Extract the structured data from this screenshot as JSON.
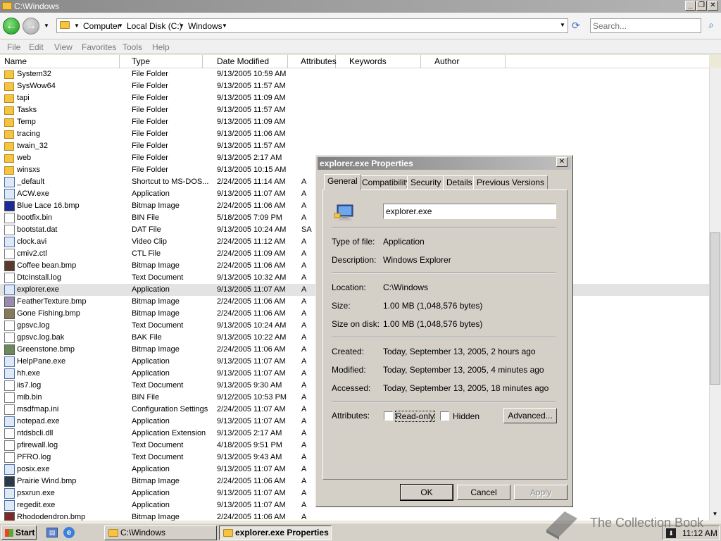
{
  "window": {
    "title": "C:\\Windows"
  },
  "nav": {
    "back_glyph": "←",
    "forward_glyph": "→",
    "breadcrumbs": [
      "Computer",
      "Local Disk (C:)",
      "Windows"
    ],
    "search_placeholder": "Search..."
  },
  "menu": [
    "File",
    "Edit",
    "View",
    "Favorites",
    "Tools",
    "Help"
  ],
  "columns": [
    "Name",
    "Type",
    "Date Modified",
    "Attributes",
    "Keywords",
    "Author"
  ],
  "files": [
    {
      "name": "System32",
      "type": "File Folder",
      "date": "9/13/2005 10:59 AM",
      "attr": "",
      "icon": "folder"
    },
    {
      "name": "SysWow64",
      "type": "File Folder",
      "date": "9/13/2005 11:57 AM",
      "attr": "",
      "icon": "folder"
    },
    {
      "name": "tapi",
      "type": "File Folder",
      "date": "9/13/2005 11:09 AM",
      "attr": "",
      "icon": "folder"
    },
    {
      "name": "Tasks",
      "type": "File Folder",
      "date": "9/13/2005 11:57 AM",
      "attr": "",
      "icon": "folder"
    },
    {
      "name": "Temp",
      "type": "File Folder",
      "date": "9/13/2005 11:09 AM",
      "attr": "",
      "icon": "folder"
    },
    {
      "name": "tracing",
      "type": "File Folder",
      "date": "9/13/2005 11:06 AM",
      "attr": "",
      "icon": "folder"
    },
    {
      "name": "twain_32",
      "type": "File Folder",
      "date": "9/13/2005 11:57 AM",
      "attr": "",
      "icon": "folder"
    },
    {
      "name": "web",
      "type": "File Folder",
      "date": "9/13/2005 2:17 AM",
      "attr": "",
      "icon": "folder"
    },
    {
      "name": "winsxs",
      "type": "File Folder",
      "date": "9/13/2005 10:15 AM",
      "attr": "",
      "icon": "folder"
    },
    {
      "name": "_default",
      "type": "Shortcut to MS-DOS...",
      "date": "2/24/2005 11:14 AM",
      "attr": "A",
      "icon": "app"
    },
    {
      "name": "ACW.exe",
      "type": "Application",
      "date": "9/13/2005 11:07 AM",
      "attr": "A",
      "icon": "app"
    },
    {
      "name": "Blue Lace 16.bmp",
      "type": "Bitmap Image",
      "date": "2/24/2005 11:06 AM",
      "attr": "A",
      "icon": "img",
      "color": "#1a2a9a"
    },
    {
      "name": "bootfix.bin",
      "type": "BIN File",
      "date": "5/18/2005 7:09 PM",
      "attr": "A",
      "icon": "doc"
    },
    {
      "name": "bootstat.dat",
      "type": "DAT File",
      "date": "9/13/2005 10:24 AM",
      "attr": "SA",
      "icon": "doc"
    },
    {
      "name": "clock.avi",
      "type": "Video Clip",
      "date": "2/24/2005 11:12 AM",
      "attr": "A",
      "icon": "app"
    },
    {
      "name": "cmiv2.ctl",
      "type": "CTL File",
      "date": "2/24/2005 11:09 AM",
      "attr": "A",
      "icon": "doc"
    },
    {
      "name": "Coffee bean.bmp",
      "type": "Bitmap Image",
      "date": "2/24/2005 11:06 AM",
      "attr": "A",
      "icon": "img",
      "color": "#5a3a2a"
    },
    {
      "name": "DtcInstall.log",
      "type": "Text Document",
      "date": "9/13/2005 10:32 AM",
      "attr": "A",
      "icon": "doc"
    },
    {
      "name": "explorer.exe",
      "type": "Application",
      "date": "9/13/2005 11:07 AM",
      "attr": "A",
      "icon": "app",
      "selected": true
    },
    {
      "name": "FeatherTexture.bmp",
      "type": "Bitmap Image",
      "date": "2/24/2005 11:06 AM",
      "attr": "A",
      "icon": "img",
      "color": "#9a8ab0"
    },
    {
      "name": "Gone Fishing.bmp",
      "type": "Bitmap Image",
      "date": "2/24/2005 11:06 AM",
      "attr": "A",
      "icon": "img",
      "color": "#8a7a5a"
    },
    {
      "name": "gpsvc.log",
      "type": "Text Document",
      "date": "9/13/2005 10:24 AM",
      "attr": "A",
      "icon": "doc"
    },
    {
      "name": "gpsvc.log.bak",
      "type": "BAK File",
      "date": "9/13/2005 10:22 AM",
      "attr": "A",
      "icon": "doc"
    },
    {
      "name": "Greenstone.bmp",
      "type": "Bitmap Image",
      "date": "2/24/2005 11:06 AM",
      "attr": "A",
      "icon": "img",
      "color": "#6a8a5a"
    },
    {
      "name": "HelpPane.exe",
      "type": "Application",
      "date": "9/13/2005 11:07 AM",
      "attr": "A",
      "icon": "app"
    },
    {
      "name": "hh.exe",
      "type": "Application",
      "date": "9/13/2005 11:07 AM",
      "attr": "A",
      "icon": "app"
    },
    {
      "name": "iis7.log",
      "type": "Text Document",
      "date": "9/13/2005 9:30 AM",
      "attr": "A",
      "icon": "doc"
    },
    {
      "name": "mib.bin",
      "type": "BIN File",
      "date": "9/12/2005 10:53 PM",
      "attr": "A",
      "icon": "doc"
    },
    {
      "name": "msdfmap.ini",
      "type": "Configuration Settings",
      "date": "2/24/2005 11:07 AM",
      "attr": "A",
      "icon": "doc"
    },
    {
      "name": "notepad.exe",
      "type": "Application",
      "date": "9/13/2005 11:07 AM",
      "attr": "A",
      "icon": "app"
    },
    {
      "name": "ntdsbcli.dll",
      "type": "Application Extension",
      "date": "9/13/2005 2:17 AM",
      "attr": "A",
      "icon": "doc"
    },
    {
      "name": "pfirewall.log",
      "type": "Text Document",
      "date": "4/18/2005 9:51 PM",
      "attr": "A",
      "icon": "doc"
    },
    {
      "name": "PFRO.log",
      "type": "Text Document",
      "date": "9/13/2005 9:43 AM",
      "attr": "A",
      "icon": "doc"
    },
    {
      "name": "posix.exe",
      "type": "Application",
      "date": "9/13/2005 11:07 AM",
      "attr": "A",
      "icon": "app"
    },
    {
      "name": "Prairie Wind.bmp",
      "type": "Bitmap Image",
      "date": "2/24/2005 11:06 AM",
      "attr": "A",
      "icon": "img",
      "color": "#2a3a4a"
    },
    {
      "name": "psxrun.exe",
      "type": "Application",
      "date": "9/13/2005 11:07 AM",
      "attr": "A",
      "icon": "app"
    },
    {
      "name": "regedit.exe",
      "type": "Application",
      "date": "9/13/2005 11:07 AM",
      "attr": "A",
      "icon": "app"
    },
    {
      "name": "Rhododendron.bmp",
      "type": "Bitmap Image",
      "date": "2/24/2005 11:06 AM",
      "attr": "A",
      "icon": "img",
      "color": "#7a2a2a"
    }
  ],
  "dialog": {
    "title": "explorer.exe Properties",
    "tabs": [
      "General",
      "Compatibility",
      "Security",
      "Details",
      "Previous Versions"
    ],
    "filename": "explorer.exe",
    "type_label": "Type of file:",
    "type_value": "Application",
    "desc_label": "Description:",
    "desc_value": "Windows Explorer",
    "location_label": "Location:",
    "location_value": "C:\\Windows",
    "size_label": "Size:",
    "size_value": "1.00 MB (1,048,576 bytes)",
    "sizedisk_label": "Size on disk:",
    "sizedisk_value": "1.00 MB (1,048,576 bytes)",
    "created_label": "Created:",
    "created_value": "Today, September 13, 2005, 2 hours ago",
    "modified_label": "Modified:",
    "modified_value": "Today, September 13, 2005, 4 minutes ago",
    "accessed_label": "Accessed:",
    "accessed_value": "Today, September 13, 2005, 18 minutes ago",
    "attributes_label": "Attributes:",
    "readonly_label": "Read-only",
    "hidden_label": "Hidden",
    "advanced_label": "Advanced...",
    "ok_label": "OK",
    "cancel_label": "Cancel",
    "apply_label": "Apply"
  },
  "taskbar": {
    "start_label": "Start",
    "tasks": [
      "C:\\Windows",
      "explorer.exe Properties"
    ],
    "clock": "11:12 AM"
  },
  "watermark": "The Collection Book"
}
